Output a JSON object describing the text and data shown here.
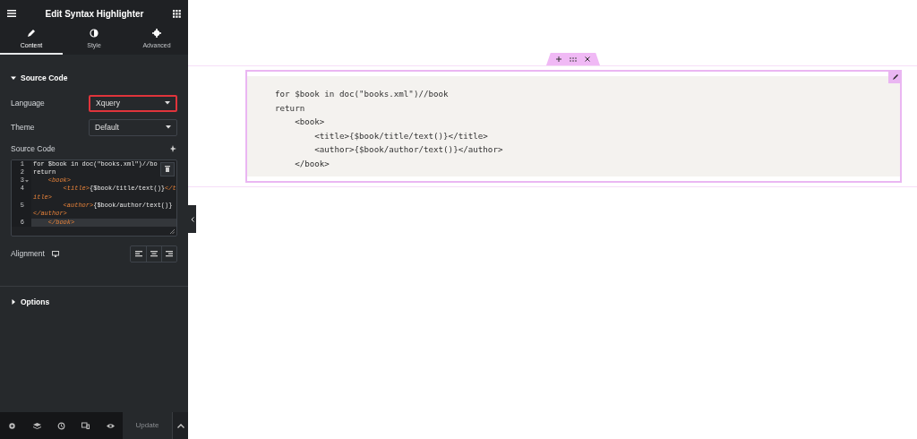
{
  "panel": {
    "title": "Edit Syntax Highlighter",
    "tabs": [
      {
        "label": "Content",
        "selected": true
      },
      {
        "label": "Style",
        "selected": false
      },
      {
        "label": "Advanced",
        "selected": false
      }
    ],
    "sections": [
      {
        "title": "Source Code",
        "expanded": true
      },
      {
        "title": "Options",
        "expanded": false
      }
    ],
    "language": {
      "label": "Language",
      "value": "Xquery",
      "highlighted": true
    },
    "theme": {
      "label": "Theme",
      "value": "Default",
      "highlighted": false
    },
    "source_code": {
      "label": "Source Code",
      "lines": [
        {
          "number": "1",
          "active": false,
          "fold": false,
          "parts": [
            {
              "kind": "plain",
              "text": "for $book in doc(\"books.xml\")//bo"
            }
          ]
        },
        {
          "number": "2",
          "active": false,
          "fold": false,
          "parts": [
            {
              "kind": "plain",
              "text": "return"
            }
          ]
        },
        {
          "number": "3",
          "active": false,
          "fold": true,
          "parts": [
            {
              "kind": "tag",
              "text": "    <book>"
            }
          ]
        },
        {
          "number": "4",
          "active": false,
          "fold": false,
          "parts": [
            {
              "kind": "tag",
              "text": "        <title>"
            },
            {
              "kind": "plain",
              "text": "{$book/title/text()}"
            },
            {
              "kind": "tag",
              "text": "</title>"
            }
          ]
        },
        {
          "number": "5",
          "active": false,
          "fold": false,
          "parts": [
            {
              "kind": "tag",
              "text": "        <author>"
            },
            {
              "kind": "plain",
              "text": "{$book/author/text()}"
            },
            {
              "kind": "tag",
              "text": "</author>"
            }
          ]
        },
        {
          "number": "6",
          "active": true,
          "fold": false,
          "parts": [
            {
              "kind": "tag",
              "text": "    </book>"
            }
          ]
        }
      ]
    },
    "alignment": {
      "label": "Alignment",
      "options": [
        {
          "selected": false
        },
        {
          "selected": false
        },
        {
          "selected": false
        }
      ]
    },
    "footer": {
      "update": "Update"
    }
  },
  "preview": {
    "code": [
      "for $book in doc(\"books.xml\")//book",
      "return",
      "    <book>",
      "        <title>{$book/title/text()}</title>",
      "        <author>{$book/author/text()}</author>",
      "    </book>"
    ]
  }
}
